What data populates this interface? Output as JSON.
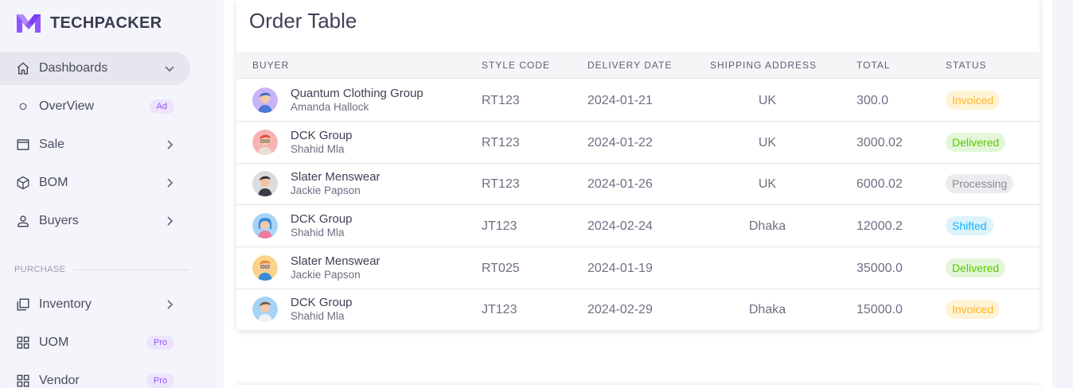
{
  "brand": {
    "name": "TECHPACKER",
    "logo_color": "#9155fd"
  },
  "sidebar": {
    "items": [
      {
        "label": "Dashboards",
        "icon": "home-icon",
        "active": true,
        "chevron": "down"
      },
      {
        "label": "OverView",
        "icon": "circle-outline-icon",
        "badge": "Ad"
      },
      {
        "label": "Sale",
        "icon": "window-icon",
        "chevron": "right"
      },
      {
        "label": "BOM",
        "icon": "cube-icon",
        "chevron": "right"
      },
      {
        "label": "Buyers",
        "icon": "account-icon",
        "chevron": "right"
      }
    ],
    "section_purchase": "PURCHASE",
    "purchase_items": [
      {
        "label": "Inventory",
        "icon": "inventory-icon",
        "chevron": "right"
      },
      {
        "label": "UOM",
        "icon": "grid-icon",
        "badge": "Pro"
      },
      {
        "label": "Vendor",
        "icon": "grid-icon",
        "badge": "Pro"
      }
    ]
  },
  "order_table": {
    "title": "Order Table",
    "columns": [
      "BUYER",
      "STYLE CODE",
      "DELIVERY DATE",
      "SHIPPING ADDRESS",
      "TOTAL",
      "STATUS"
    ],
    "rows": [
      {
        "buyer": "Quantum Clothing Group",
        "contact": "Amanda Hallock",
        "style_code": "RT123",
        "delivery_date": "2024-01-21",
        "shipping_address": "UK",
        "total": "300.0",
        "status": "Invoiced"
      },
      {
        "buyer": "DCK Group",
        "contact": "Shahid Mla",
        "style_code": "RT123",
        "delivery_date": "2024-01-22",
        "shipping_address": "UK",
        "total": "3000.02",
        "status": "Delivered"
      },
      {
        "buyer": "Slater Menswear",
        "contact": "Jackie Papson",
        "style_code": "RT123",
        "delivery_date": "2024-01-26",
        "shipping_address": "UK",
        "total": "6000.02",
        "status": "Processing"
      },
      {
        "buyer": "DCK Group",
        "contact": "Shahid Mla",
        "style_code": "JT123",
        "delivery_date": "2024-02-24",
        "shipping_address": "Dhaka",
        "total": "12000.2",
        "status": "Shifted"
      },
      {
        "buyer": "Slater Menswear",
        "contact": "Jackie Papson",
        "style_code": "RT025",
        "delivery_date": "2024-01-19",
        "shipping_address": "",
        "total": "35000.0",
        "status": "Delivered"
      },
      {
        "buyer": "DCK Group",
        "contact": "Shahid Mla",
        "style_code": "JT123",
        "delivery_date": "2024-02-29",
        "shipping_address": "Dhaka",
        "total": "15000.0",
        "status": "Invoiced"
      }
    ]
  },
  "status_colors": {
    "Invoiced": {
      "bg": "#fff3d6",
      "fg": "#fdb528"
    },
    "Delivered": {
      "bg": "#e4f6d9",
      "fg": "#56ca00"
    },
    "Processing": {
      "bg": "#ececef",
      "fg": "#8a8d93"
    },
    "Shifted": {
      "bg": "#dcf3fc",
      "fg": "#16b1ff"
    }
  }
}
